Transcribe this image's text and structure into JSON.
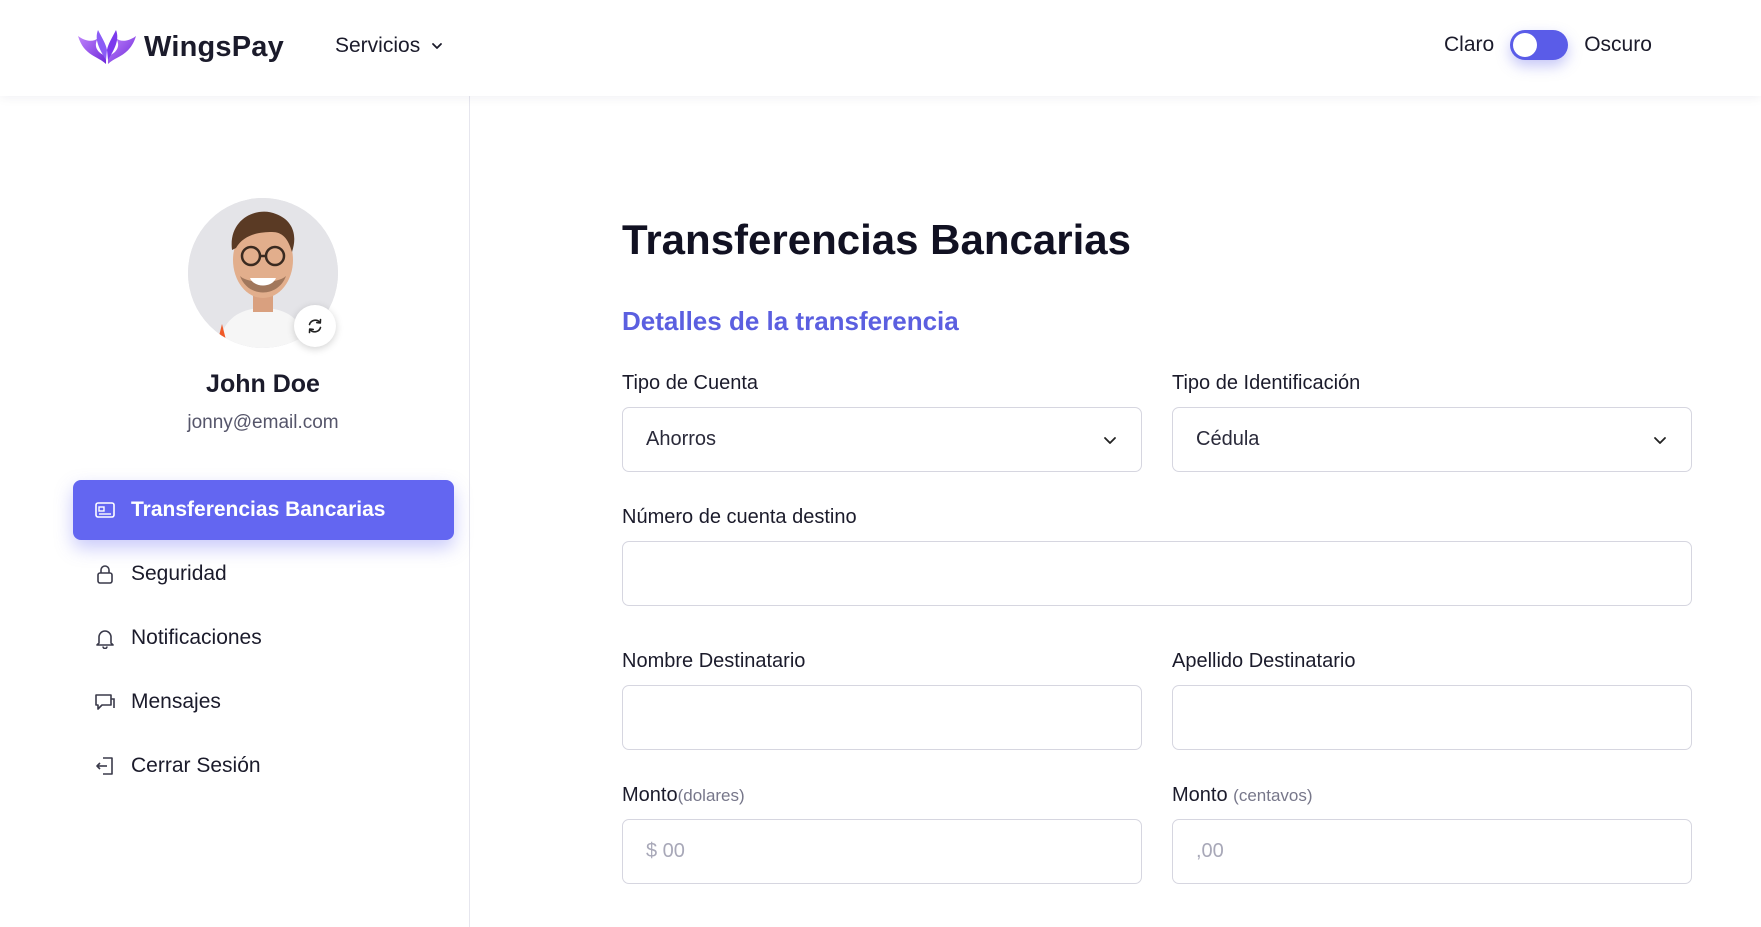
{
  "header": {
    "brand": "WingsPay",
    "services_label": "Servicios",
    "theme": {
      "light_label": "Claro",
      "dark_label": "Oscuro"
    }
  },
  "colors": {
    "accent": "#6366f1",
    "section_title": "#5b5fe0"
  },
  "sidebar": {
    "user_name": "John Doe",
    "user_email": "jonny@email.com",
    "items": [
      {
        "label": "Transferencias Bancarias",
        "icon": "card-icon",
        "active": true
      },
      {
        "label": "Seguridad",
        "icon": "lock-icon",
        "active": false
      },
      {
        "label": "Notificaciones",
        "icon": "bell-icon",
        "active": false
      },
      {
        "label": "Mensajes",
        "icon": "chat-icon",
        "active": false
      },
      {
        "label": "Cerrar Sesión",
        "icon": "logout-icon",
        "active": false
      }
    ]
  },
  "main": {
    "title": "Transferencias Bancarias",
    "section_title": "Detalles de la transferencia",
    "form": {
      "account_type": {
        "label": "Tipo de Cuenta",
        "value": "Ahorros"
      },
      "id_type": {
        "label": "Tipo de Identificación",
        "value": "Cédula"
      },
      "account_number": {
        "label": "Número de cuenta destino",
        "placeholder": ""
      },
      "first_name": {
        "label": "Nombre Destinatario",
        "placeholder": ""
      },
      "last_name": {
        "label": "Apellido Destinatario",
        "placeholder": ""
      },
      "amount_dollars": {
        "label": "Monto",
        "hint": "(dolares)",
        "placeholder": "$ 00"
      },
      "amount_cents": {
        "label": "Monto",
        "hint": "(centavos)",
        "placeholder": ",00"
      }
    }
  }
}
